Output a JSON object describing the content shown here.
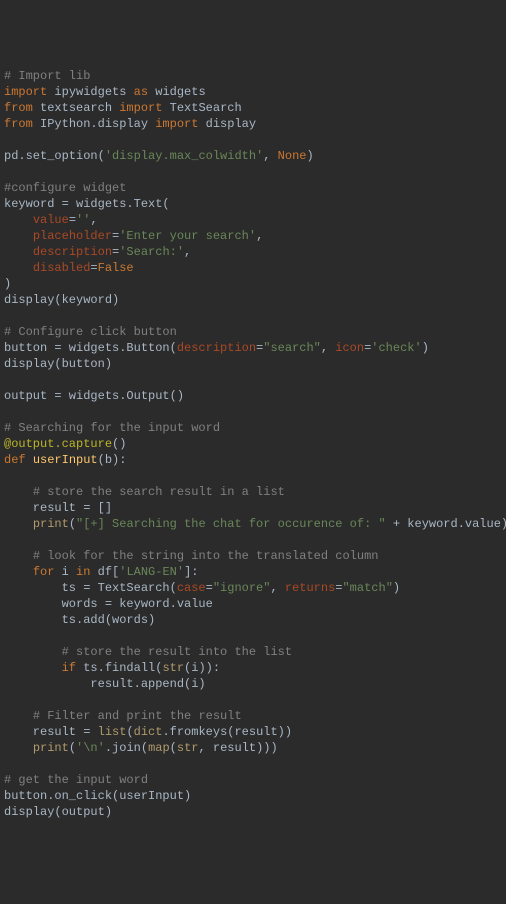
{
  "lines": [
    [
      [
        "c-comment",
        "# Import lib"
      ]
    ],
    [
      [
        "c-keyword",
        "import"
      ],
      [
        "c-ident",
        " ipywidgets "
      ],
      [
        "c-keyword",
        "as"
      ],
      [
        "c-ident",
        " widgets"
      ]
    ],
    [
      [
        "c-keyword",
        "from"
      ],
      [
        "c-ident",
        " textsearch "
      ],
      [
        "c-keyword",
        "import"
      ],
      [
        "c-ident",
        " TextSearch"
      ]
    ],
    [
      [
        "c-keyword",
        "from"
      ],
      [
        "c-ident",
        " IPython.display "
      ],
      [
        "c-keyword",
        "import"
      ],
      [
        "c-ident",
        " display"
      ]
    ],
    [],
    [
      [
        "c-ident",
        "pd.set_option("
      ],
      [
        "c-string",
        "'display.max_colwidth'"
      ],
      [
        "c-punct",
        ", "
      ],
      [
        "c-const",
        "None"
      ],
      [
        "c-punct",
        ")"
      ]
    ],
    [],
    [
      [
        "c-comment",
        "#configure widget"
      ]
    ],
    [
      [
        "c-ident",
        "keyword = widgets.Text("
      ]
    ],
    [
      [
        "c-ident",
        "    "
      ],
      [
        "c-param",
        "value"
      ],
      [
        "c-punct",
        "="
      ],
      [
        "c-string",
        "''"
      ],
      [
        "c-punct",
        ","
      ]
    ],
    [
      [
        "c-ident",
        "    "
      ],
      [
        "c-param",
        "placeholder"
      ],
      [
        "c-punct",
        "="
      ],
      [
        "c-string",
        "'Enter your search'"
      ],
      [
        "c-punct",
        ","
      ]
    ],
    [
      [
        "c-ident",
        "    "
      ],
      [
        "c-param",
        "description"
      ],
      [
        "c-punct",
        "="
      ],
      [
        "c-string",
        "'Search:'"
      ],
      [
        "c-punct",
        ","
      ]
    ],
    [
      [
        "c-ident",
        "    "
      ],
      [
        "c-param",
        "disabled"
      ],
      [
        "c-punct",
        "="
      ],
      [
        "c-const",
        "False"
      ]
    ],
    [
      [
        "c-punct",
        ")"
      ]
    ],
    [
      [
        "c-ident",
        "display(keyword)"
      ]
    ],
    [],
    [
      [
        "c-comment",
        "# Configure click button"
      ]
    ],
    [
      [
        "c-ident",
        "button = widgets.Button("
      ],
      [
        "c-param",
        "description"
      ],
      [
        "c-punct",
        "="
      ],
      [
        "c-string",
        "\"search\""
      ],
      [
        "c-punct",
        ", "
      ],
      [
        "c-param",
        "icon"
      ],
      [
        "c-punct",
        "="
      ],
      [
        "c-string",
        "'check'"
      ],
      [
        "c-punct",
        ")"
      ]
    ],
    [
      [
        "c-ident",
        "display(button)"
      ]
    ],
    [],
    [
      [
        "c-ident",
        "output = widgets.Output()"
      ]
    ],
    [],
    [
      [
        "c-comment",
        "# Searching for the input word"
      ]
    ],
    [
      [
        "c-decor",
        "@output.capture"
      ],
      [
        "c-punct",
        "()"
      ]
    ],
    [
      [
        "c-keyword",
        "def "
      ],
      [
        "c-func",
        "userInput"
      ],
      [
        "c-punct",
        "(b):"
      ]
    ],
    [],
    [
      [
        "c-ident",
        "    "
      ],
      [
        "c-comment",
        "# store the search result in a list"
      ]
    ],
    [
      [
        "c-ident",
        "    result = []"
      ]
    ],
    [
      [
        "c-ident",
        "    "
      ],
      [
        "c-call",
        "print"
      ],
      [
        "c-punct",
        "("
      ],
      [
        "c-string",
        "\"[+] Searching the chat for occurence of: \""
      ],
      [
        "c-punct",
        " + keyword.value)"
      ]
    ],
    [],
    [
      [
        "c-ident",
        "    "
      ],
      [
        "c-comment",
        "# look for the string into the translated column"
      ]
    ],
    [
      [
        "c-ident",
        "    "
      ],
      [
        "c-keyword",
        "for"
      ],
      [
        "c-ident",
        " i "
      ],
      [
        "c-keyword",
        "in"
      ],
      [
        "c-ident",
        " df["
      ],
      [
        "c-string",
        "'LANG-EN'"
      ],
      [
        "c-punct",
        "]:"
      ]
    ],
    [
      [
        "c-ident",
        "        ts = TextSearch("
      ],
      [
        "c-param",
        "case"
      ],
      [
        "c-punct",
        "="
      ],
      [
        "c-string",
        "\"ignore\""
      ],
      [
        "c-punct",
        ", "
      ],
      [
        "c-param",
        "returns"
      ],
      [
        "c-punct",
        "="
      ],
      [
        "c-string",
        "\"match\""
      ],
      [
        "c-punct",
        ")"
      ]
    ],
    [
      [
        "c-ident",
        "        words = keyword.value"
      ]
    ],
    [
      [
        "c-ident",
        "        ts.add(words)"
      ]
    ],
    [],
    [
      [
        "c-ident",
        "        "
      ],
      [
        "c-comment",
        "# store the result into the list"
      ]
    ],
    [
      [
        "c-ident",
        "        "
      ],
      [
        "c-keyword",
        "if"
      ],
      [
        "c-ident",
        " ts.findall("
      ],
      [
        "c-call",
        "str"
      ],
      [
        "c-punct",
        "(i)):"
      ]
    ],
    [
      [
        "c-ident",
        "            result.append(i)"
      ]
    ],
    [],
    [
      [
        "c-ident",
        "    "
      ],
      [
        "c-comment",
        "# Filter and print the result"
      ]
    ],
    [
      [
        "c-ident",
        "    result = "
      ],
      [
        "c-call",
        "list"
      ],
      [
        "c-punct",
        "("
      ],
      [
        "c-call",
        "dict"
      ],
      [
        "c-punct",
        ".fromkeys(result))"
      ]
    ],
    [
      [
        "c-ident",
        "    "
      ],
      [
        "c-call",
        "print"
      ],
      [
        "c-punct",
        "("
      ],
      [
        "c-string",
        "'\\n'"
      ],
      [
        "c-punct",
        ".join("
      ],
      [
        "c-call",
        "map"
      ],
      [
        "c-punct",
        "("
      ],
      [
        "c-call",
        "str"
      ],
      [
        "c-punct",
        ", result)))"
      ]
    ],
    [],
    [
      [
        "c-comment",
        "# get the input word"
      ]
    ],
    [
      [
        "c-ident",
        "button.on_click(userInput)"
      ]
    ],
    [
      [
        "c-ident",
        "display(output)"
      ]
    ]
  ]
}
